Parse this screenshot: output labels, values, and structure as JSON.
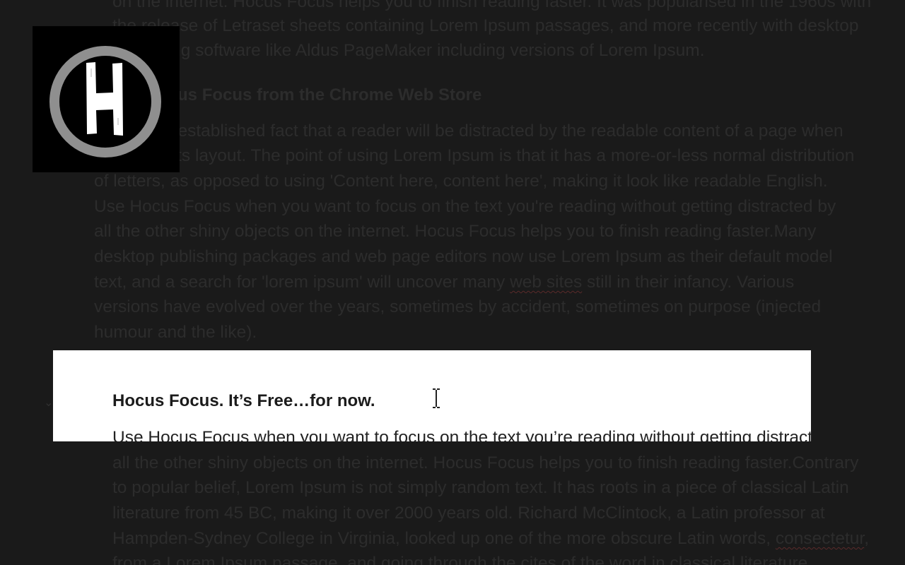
{
  "logo": {
    "icon": "hocus-focus-h-logo"
  },
  "dimmed_top": {
    "paragraph_tail": [
      "on the internet. Hocus Focus helps you to finish reading faster. It was popularised in the 1960s with",
      "the release of Letraset sheets containing Lorem Ipsum passages, and more recently with desktop",
      "publishing software like Aldus PageMaker including versions of Lorem Ipsum."
    ],
    "heading": "Get Hocus Focus from the Chrome Web Store",
    "paragraph": [
      "It is a long established fact that a reader will be distracted by the readable content of a page when",
      "looking at its layout. The point of using Lorem Ipsum is that it has a more-or-less normal distribution",
      "of letters, as opposed to using 'Content here, content here', making it look like readable English.",
      "Use Hocus Focus when you want to focus on the text you're reading without getting distracted by",
      "all the other shiny objects on the internet. Hocus Focus helps you to finish reading faster.Many",
      "desktop publishing packages and web page editors now use Lorem Ipsum as their default model",
      "text, and a search for 'lorem ipsum' will uncover many web sites still in their infancy. Various",
      "versions have evolved over the years, sometimes by accident, sometimes on purpose (injected",
      "humour and the like)."
    ],
    "misspelled_word": "web sites"
  },
  "focused": {
    "heading": "Hocus Focus. It’s Free…for now.",
    "first_line": "Use Hocus Focus when you want to focus on the text you’re reading without getting distracted by"
  },
  "dimmed_bottom": {
    "paragraph": [
      "all the other shiny objects on the internet. Hocus Focus helps you to finish reading faster.Contrary",
      "to popular belief, Lorem Ipsum is not simply random text. It has roots in a piece of classical Latin",
      "literature from 45 BC, making it over 2000 years old. Richard McClintock, a Latin professor at",
      "Hampden-Sydney College in Virginia, looked up one of the more obscure Latin words, consectetur,",
      "from a Lorem Ipsum passage, and going through the cites of the word in classical literature,"
    ],
    "misspelled_word": "consectetur"
  },
  "cursor": {
    "icon": "text-cursor-icon"
  },
  "chevron": {
    "icon": "chevron-down-icon"
  },
  "colors": {
    "overlay": "#1a1a1a",
    "dimmed_text": "#2c2c2c",
    "focus_band": "#ffffff",
    "focus_text": "#1b1b1b"
  }
}
